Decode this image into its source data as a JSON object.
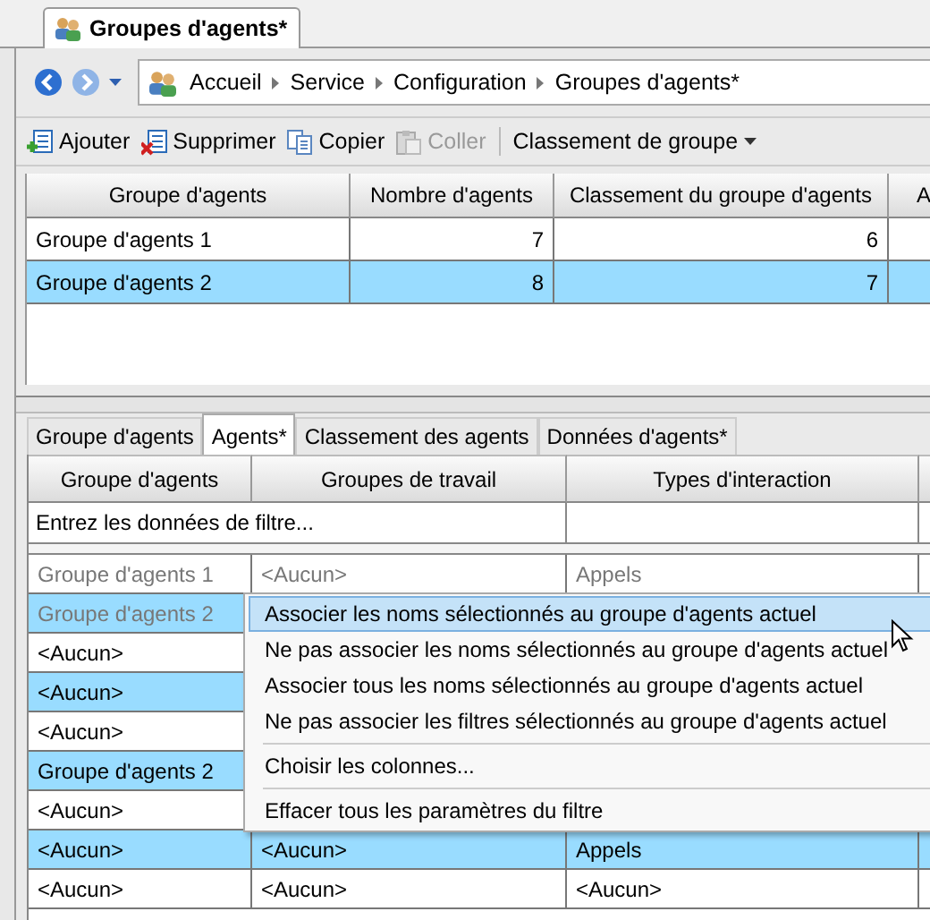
{
  "document_tab": {
    "title": "Groupes d'agents*"
  },
  "navigation": {
    "breadcrumb": [
      "Accueil",
      "Service",
      "Configuration",
      "Groupes d'agents*"
    ]
  },
  "toolbar": {
    "buttons": [
      {
        "label": "Ajouter",
        "disabled": false
      },
      {
        "label": "Supprimer",
        "disabled": false
      },
      {
        "label": "Copier",
        "disabled": false
      },
      {
        "label": "Coller",
        "disabled": true
      }
    ],
    "dropdown": "Classement de groupe"
  },
  "upper_table": {
    "columns": [
      "Groupe d'agents",
      "Nombre d'agents",
      "Classement du groupe d'agents",
      "A"
    ],
    "rows": [
      {
        "cells": [
          "Groupe d'agents 1",
          "7",
          "6"
        ],
        "selected": false
      },
      {
        "cells": [
          "Groupe d'agents 2",
          "8",
          "7"
        ],
        "selected": true
      }
    ]
  },
  "detail_tabs": [
    {
      "label": "Groupe d'agents",
      "selected": false
    },
    {
      "label": "Agents*",
      "selected": true
    },
    {
      "label": "Classement des agents",
      "selected": false
    },
    {
      "label": "Données d'agents*",
      "selected": false
    }
  ],
  "lower_table": {
    "columns": [
      "Groupe d'agents",
      "Groupes de travail",
      "Types d'interaction"
    ],
    "filter_placeholder": "Entrez les données de filtre...",
    "rows": [
      {
        "cells": [
          "Groupe d'agents 1",
          "<Aucun>",
          "Appels"
        ],
        "selected": false,
        "dimmed": true
      },
      {
        "cells": [
          "Groupe d'agents 2"
        ],
        "selected": true,
        "dimmed": true
      },
      {
        "cells": [
          "<Aucun>"
        ],
        "selected": false,
        "dimmed": false
      },
      {
        "cells": [
          "<Aucun>"
        ],
        "selected": true,
        "dimmed": false
      },
      {
        "cells": [
          "<Aucun>"
        ],
        "selected": false,
        "dimmed": false
      },
      {
        "cells": [
          "Groupe d'agents 2"
        ],
        "selected": true,
        "dimmed": false
      },
      {
        "cells": [
          "<Aucun>"
        ],
        "selected": false,
        "dimmed": false
      },
      {
        "cells": [
          "<Aucun>",
          "<Aucun>",
          "Appels"
        ],
        "selected": true,
        "dimmed": false
      },
      {
        "cells": [
          "<Aucun>",
          "<Aucun>",
          "<Aucun>"
        ],
        "selected": false,
        "dimmed": false
      }
    ]
  },
  "context_menu": {
    "items": [
      {
        "kind": "item",
        "label": "Associer les noms sélectionnés au groupe d'agents actuel",
        "selected": true
      },
      {
        "kind": "item",
        "label": "Ne pas associer les noms sélectionnés au groupe d'agents actuel",
        "selected": false
      },
      {
        "kind": "item",
        "label": "Associer tous les noms sélectionnés au groupe d'agents actuel",
        "selected": false
      },
      {
        "kind": "item",
        "label": "Ne pas associer les filtres sélectionnés au groupe d'agents actuel",
        "selected": false
      },
      {
        "kind": "separator"
      },
      {
        "kind": "item",
        "label": "Choisir les colonnes...",
        "selected": false
      },
      {
        "kind": "separator"
      },
      {
        "kind": "item",
        "label": "Effacer tous les paramètres du filtre",
        "selected": false
      }
    ]
  }
}
